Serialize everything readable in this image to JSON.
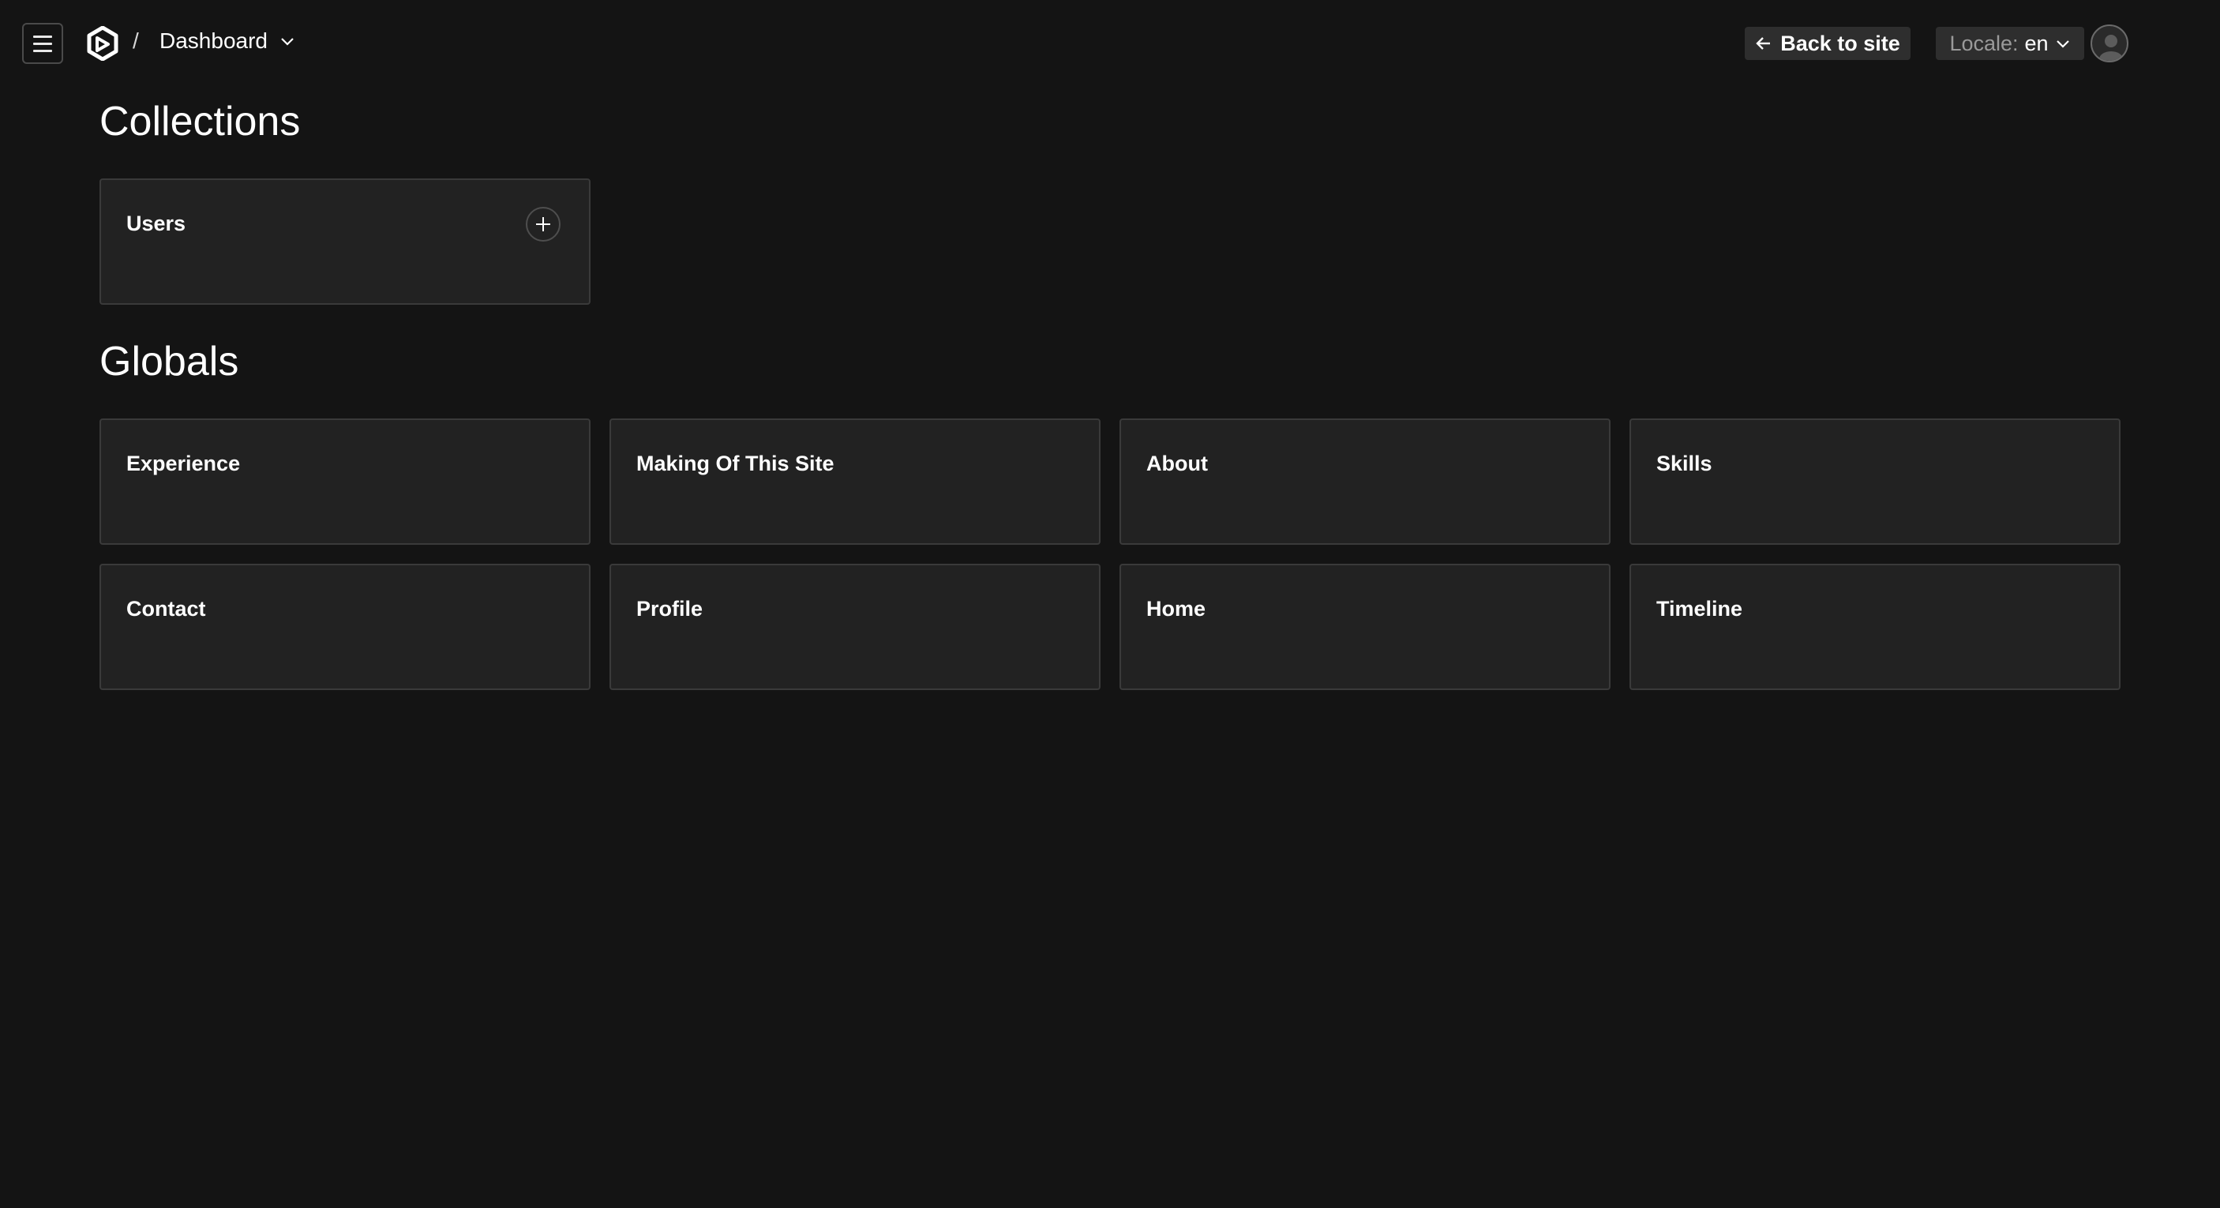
{
  "header": {
    "separator": "/",
    "breadcrumb": "Dashboard",
    "back_button": "Back to site",
    "locale_label": "Locale:",
    "locale_value": "en"
  },
  "collections": {
    "title": "Collections",
    "items": [
      {
        "label": "Users"
      }
    ]
  },
  "globals": {
    "title": "Globals",
    "items": [
      {
        "label": "Experience"
      },
      {
        "label": "Making Of This Site"
      },
      {
        "label": "About"
      },
      {
        "label": "Skills"
      },
      {
        "label": "Contact"
      },
      {
        "label": "Profile"
      },
      {
        "label": "Home"
      },
      {
        "label": "Timeline"
      }
    ]
  },
  "icons": {
    "menu": "hamburger-menu-icon",
    "logo": "payload-logo-icon",
    "breadcrumb_chevron": "chevron-down-icon",
    "back": "arrow-left-icon",
    "locale_chevron": "chevron-down-icon",
    "avatar": "user-avatar-icon",
    "add": "plus-icon"
  },
  "colors": {
    "background": "#141414",
    "card": "#222222",
    "card_border": "#3a3a3a",
    "button": "#2e2e2e",
    "text": "#ffffff",
    "muted_text": "#9a9a9a"
  }
}
